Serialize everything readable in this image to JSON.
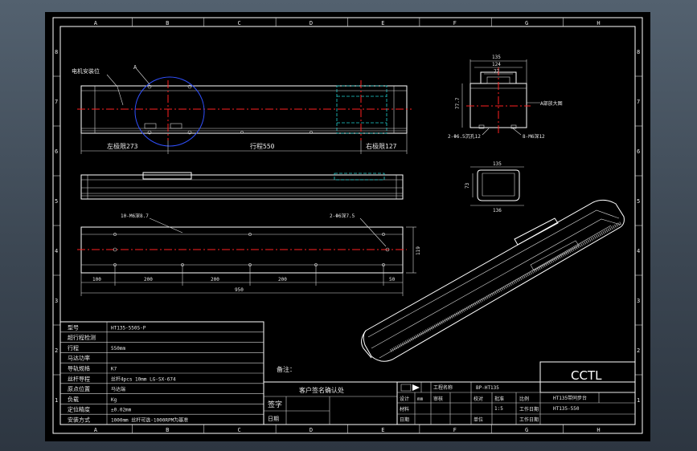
{
  "frame": {
    "top_labels": [
      "A",
      "B",
      "C",
      "D",
      "E",
      "F",
      "G",
      "H"
    ],
    "side_labels": [
      "8",
      "7",
      "6",
      "5",
      "4",
      "3",
      "2",
      "1"
    ]
  },
  "front_view": {
    "install_label": "电机安装位",
    "callout": "A",
    "dim_left": "左极限273",
    "dim_mid": "行程550",
    "dim_right": "右极限127"
  },
  "bottom_view": {
    "holes_label": "10-M6深8.7",
    "holes_right": "2-Φ6深7.5",
    "dims": [
      "100",
      "200",
      "200",
      "200",
      "50"
    ],
    "total": "950",
    "height": "119"
  },
  "section_view": {
    "w1": "135",
    "w2": "124",
    "w3": "77",
    "h": "77.7",
    "label_right": "A部放大图",
    "label_bl": "2-Φ6.5沉孔12",
    "label_br": "8-M6深12"
  },
  "end_view": {
    "w_top": "135",
    "w_bottom": "136",
    "h": "73"
  },
  "spec_table": {
    "rows": [
      {
        "k": "型号",
        "v": "HT135-550S-P"
      },
      {
        "k": "超行程检测",
        "v": ""
      },
      {
        "k": "行程",
        "v": "550mm"
      },
      {
        "k": "马达功率",
        "v": ""
      },
      {
        "k": "导轨规格",
        "v": "K7"
      },
      {
        "k": "丝杆导程",
        "v": "丝杆4pcs 10mm LG-SX-674"
      },
      {
        "k": "原点位置",
        "v": "马达端"
      },
      {
        "k": "负载",
        "v": "Kg"
      },
      {
        "k": "定位精度",
        "v": "±0.02mm"
      },
      {
        "k": "安装方式",
        "v": "1000mm 丝杆可选-1000RPM为基准"
      }
    ]
  },
  "note_label": "备注：",
  "confirm_label": "客户签名确认处",
  "sign_label": "签字",
  "date_label": "日期",
  "title_block": {
    "company": "CCTL",
    "project_label": "工程名称",
    "drawing_no": "BP-HT135",
    "product_name": "HT135带同步台",
    "code": "HT135-550",
    "cells": [
      "设计",
      "审核",
      "校对",
      "批准",
      "比例",
      "1:5",
      "材料",
      "工作日期",
      "单位",
      "工作日期",
      "mm",
      "日期"
    ]
  }
}
